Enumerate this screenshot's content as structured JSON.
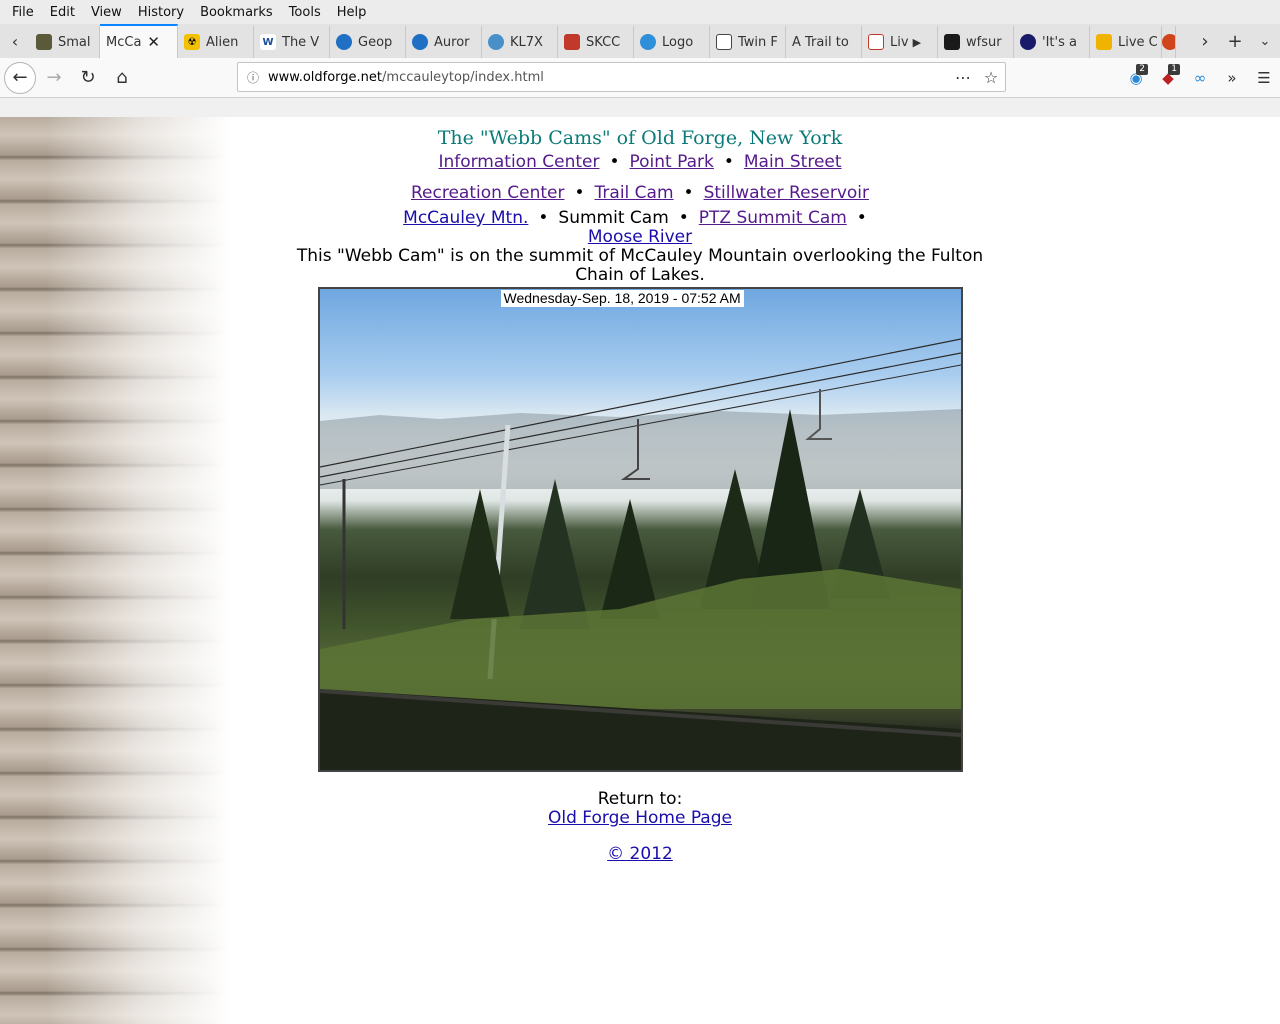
{
  "menu": [
    "File",
    "Edit",
    "View",
    "History",
    "Bookmarks",
    "Tools",
    "Help"
  ],
  "tabs": [
    {
      "label": "Smal",
      "color": "#5a5a3a"
    },
    {
      "label": "McCa",
      "active": true
    },
    {
      "label": "Alien",
      "color": "#f2c200"
    },
    {
      "label": "The V",
      "color": "#1a4d9c"
    },
    {
      "label": "Geop",
      "color": "#1f6fc4"
    },
    {
      "label": "Auror",
      "color": "#1f6fc4"
    },
    {
      "label": "KL7X",
      "color": "#4a90c8"
    },
    {
      "label": "SKCC",
      "color": "#c0392b"
    },
    {
      "label": "Logo",
      "color": "#2f8fd8"
    },
    {
      "label": "Twin F",
      "color": "#444444"
    },
    {
      "label": "A Trail to",
      "color": ""
    },
    {
      "label": "Liv",
      "color": "#c0392b"
    },
    {
      "label": "wfsur",
      "color": "#1a1a1a"
    },
    {
      "label": "'It's a",
      "color": "#1a1a6a"
    },
    {
      "label": "Live C",
      "color": "#f0b400"
    }
  ],
  "url": {
    "host": "www.oldforge.net",
    "path": "/mccauleytop/index.html"
  },
  "toolbar": {
    "badge1": "2",
    "badge2": "1"
  },
  "page": {
    "title": "The \"Webb Cams\" of Old Forge, New York",
    "links_row1": [
      "Information Center",
      "Point Park",
      "Main Street"
    ],
    "links_row2": [
      "Recreation Center",
      "Trail Cam",
      "Stillwater Reservoir"
    ],
    "row3": {
      "link1": "McCauley Mtn.",
      "current": "Summit Cam",
      "link2": "PTZ Summit Cam",
      "link3": "Moose River"
    },
    "bullet": "•",
    "description": "This \"Webb Cam\" is on the summit of McCauley Mountain overlooking the Fulton Chain of Lakes.",
    "cam_timestamp": "Wednesday-Sep. 18, 2019 - 07:52 AM",
    "return_label": "Return to:",
    "return_link": "Old Forge Home Page",
    "copyright": "© 2012"
  }
}
